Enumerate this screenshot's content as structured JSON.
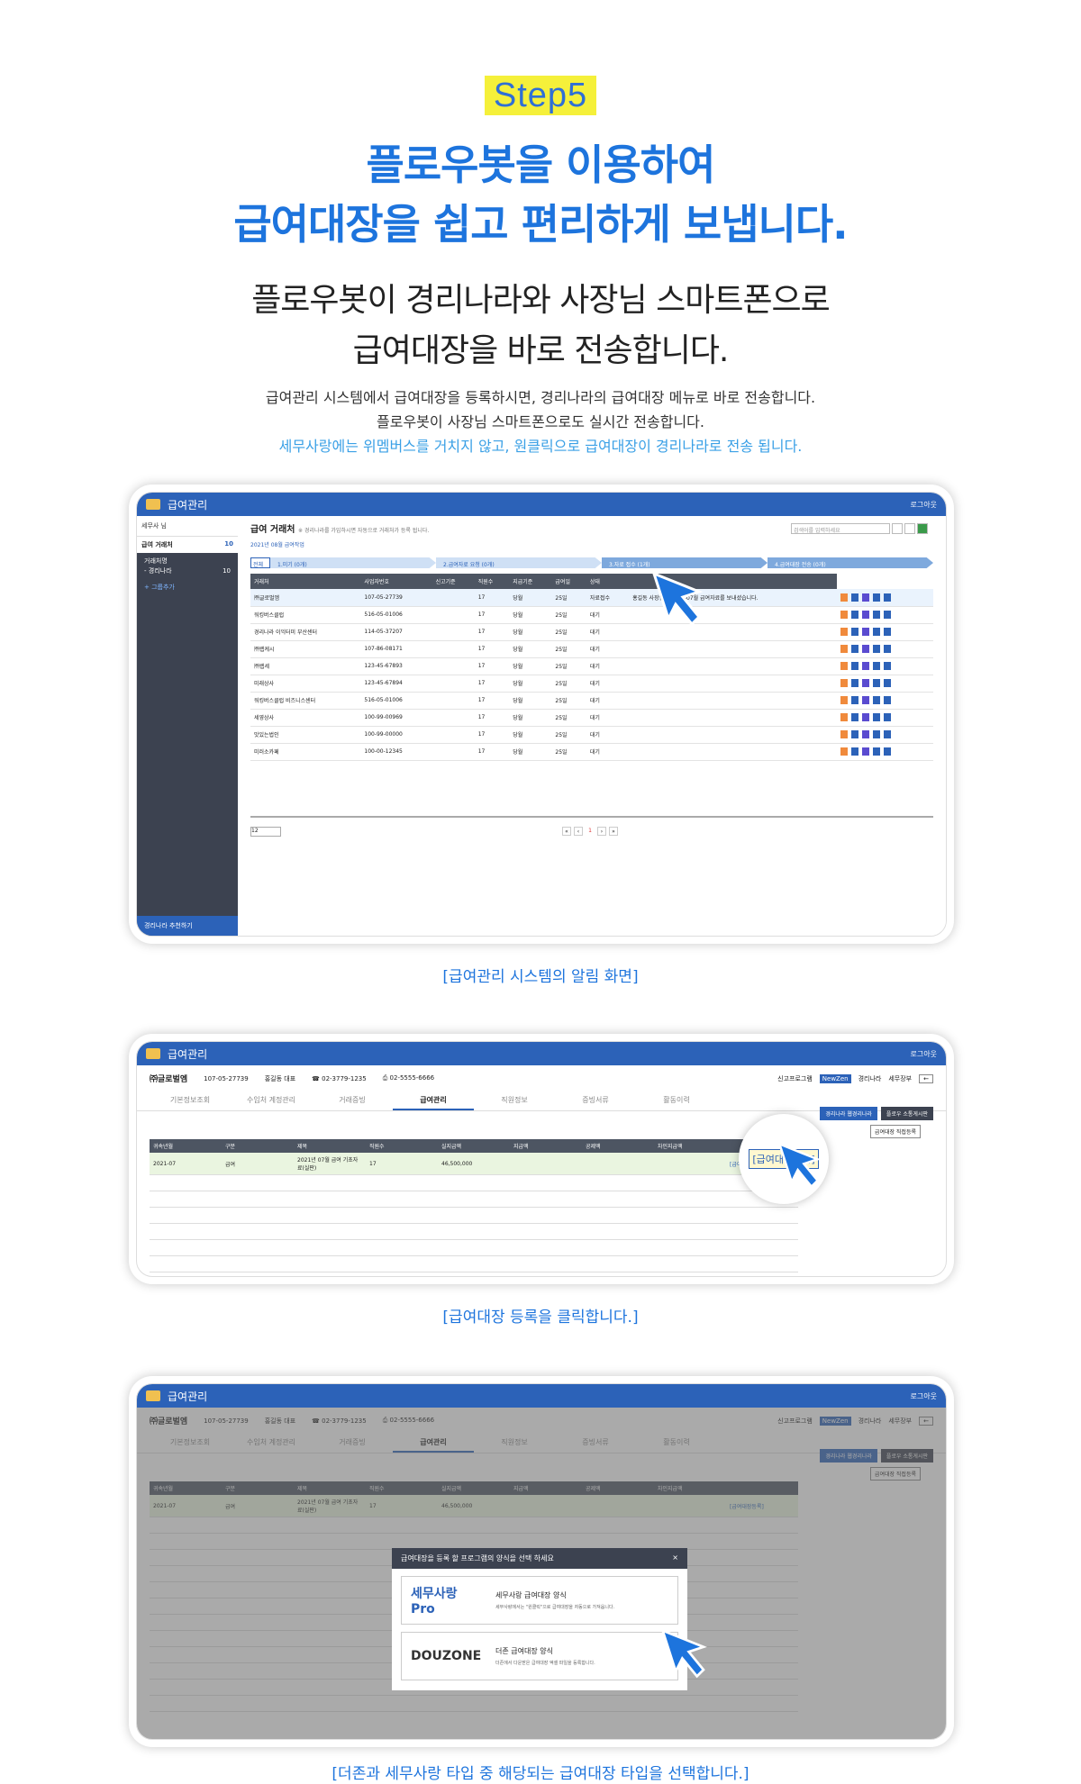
{
  "header": {
    "step": "Step5",
    "title_line1": "플로우봇을 이용하여",
    "title_line2": "급여대장을 쉽고 편리하게 보냅니다.",
    "sub_line1": "플로우봇이 경리나라와 사장님 스마트폰으로",
    "sub_line2": "급여대장을 바로 전송합니다.",
    "desc_line1": "급여관리 시스템에서 급여대장을 등록하시면, 경리나라의 급여대장 메뉴로 바로 전송합니다.",
    "desc_line2": "플로우봇이 사장님 스마트폰으로도 실시간 전송합니다.",
    "desc_line3": "세무사랑에는 위멤버스를 거치지 않고, 원클릭으로 급여대장이 경리나라로 전송 됩니다."
  },
  "colors": {
    "accent": "#1d74dd",
    "titlebar": "#2c62b8",
    "highlight": "#f5f03a"
  },
  "screen1": {
    "app_title": "급여관리",
    "logout": "로그아웃",
    "user": "세무사 님",
    "menu_active": "급여 거래처",
    "menu_count": "10",
    "group_label": "거래처명",
    "group_item": "- 경리나라",
    "group_count": "10",
    "add_group": "+ 그룹추가",
    "recommend": "경리나라 추천하기",
    "page_title": "급여 거래처",
    "page_note": "※ 경리나라를 가입하시면 자동으로 거래처가 등록 됩니다.",
    "search_placeholder": "검색어를 입력하세요",
    "month": "2021년 08월 급여작업",
    "flow": [
      "전체",
      "1.미기 (0개)",
      "2.급여자료 요청 (0개)",
      "3.자료 접수 (1개)",
      "4.급여대장 전송 (0개)"
    ],
    "columns": [
      "거래처",
      "사업자번호",
      "신고기준",
      "직원수",
      "지급기준",
      "급여일",
      "상태",
      ""
    ],
    "rows": [
      [
        "㈜글로벌엠",
        "107-05-27739",
        "",
        "17",
        "당월",
        "25일",
        "자료접수",
        "홍길동 사장님이 2021-07월 급여자료를 보내셨습니다."
      ],
      [
        "워킹버스클럽",
        "516-05-01006",
        "",
        "17",
        "당월",
        "25일",
        "대기",
        ""
      ],
      [
        "경리나라 이익터미 부산센터",
        "114-05-37207",
        "",
        "17",
        "당월",
        "25일",
        "대기",
        ""
      ],
      [
        "㈜렙케시",
        "107-86-08171",
        "",
        "17",
        "당월",
        "25일",
        "대기",
        ""
      ],
      [
        "㈜렙세",
        "123-45-67893",
        "",
        "17",
        "당월",
        "25일",
        "대기",
        ""
      ],
      [
        "미래상사",
        "123-45-67894",
        "",
        "17",
        "당월",
        "25일",
        "대기",
        ""
      ],
      [
        "워킹버스클럽 비즈니스센터",
        "516-05-01006",
        "",
        "17",
        "당월",
        "25일",
        "대기",
        ""
      ],
      [
        "세영상사",
        "100-99-00969",
        "",
        "17",
        "당월",
        "25일",
        "대기",
        ""
      ],
      [
        "맛있는법인",
        "100-99-00000",
        "",
        "17",
        "당월",
        "25일",
        "대기",
        ""
      ],
      [
        "미러소카페",
        "100-00-12345",
        "",
        "17",
        "당월",
        "25일",
        "대기",
        ""
      ]
    ],
    "page_size": "12",
    "current_page": "1",
    "caption": "[급여관리 시스템의 알림 화면]"
  },
  "screen2": {
    "app_title": "급여관리",
    "logout": "로그아웃",
    "company": "㈜글로벌엠",
    "bizno": "107-05-27739",
    "ceo": "홍길동 대표",
    "tel": "02-3779-1235",
    "fax": "02-5555-6666",
    "program": "신고프로그램",
    "program_badge": "NewZen",
    "link1": "경리나라",
    "link2": "세무장부",
    "tabs": [
      "기본정보조회",
      "수임처 계정관리",
      "거래증빙",
      "급여관리",
      "직원정보",
      "증빙서류",
      "활동이력"
    ],
    "btn1": "경리나라 웹경리나라",
    "btn2": "플로우 소통게시판",
    "register_btn": "급여대장 직접등록",
    "columns": [
      "귀속년월",
      "구분",
      "제목",
      "직원수",
      "실지급액",
      "지급액",
      "공제액",
      "차인지급액",
      ""
    ],
    "row": [
      "2021-07",
      "급여",
      "2021년 07월 급여 기초자료(실판)",
      "17",
      "46,500,000",
      "",
      "",
      "",
      "[급여대장등록]"
    ],
    "badge": "[급여대장등록]",
    "caption": "[급여대장 등록을 클릭합니다.]"
  },
  "screen3": {
    "modal_title": "급여대장을 등록 할 프로그램의 양식을 선택 하세요",
    "opt1_logo": "세무사랑 Pro",
    "opt1_title": "세무사랑 급여대장 양식",
    "opt1_desc": "세무사랑에서는 \"원클릭\"으로 급여대장을 자동으로 가져옵니다.",
    "opt2_logo": "DOUZONE",
    "opt2_title": "더존 급여대장 양식",
    "opt2_desc": "더존에서 다운받은 급여대장 엑셀 파일을 등록합니다.",
    "close": "×",
    "caption": "[더존과 세무사랑 타입 중 해당되는 급여대장 타입을 선택합니다.]"
  }
}
